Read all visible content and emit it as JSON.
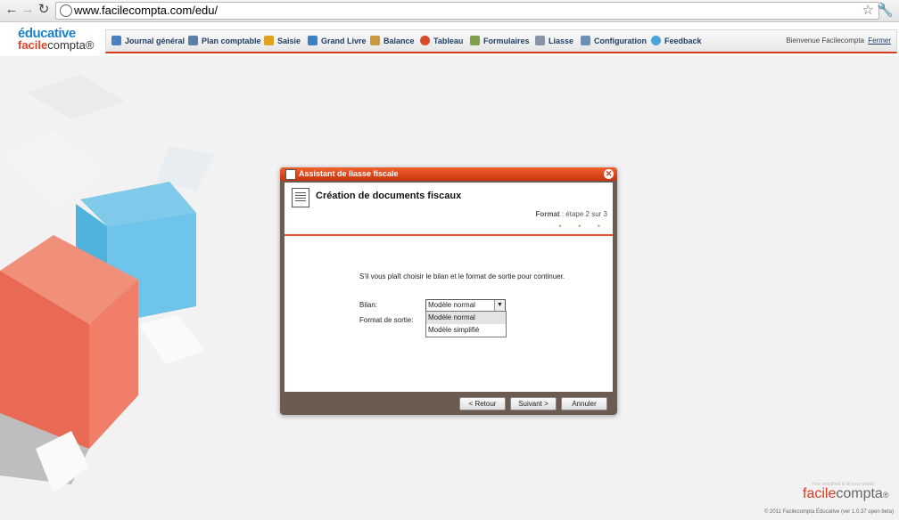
{
  "browser": {
    "url": "www.facilecompta.com/edu/",
    "back_icon": "arrow-left-icon",
    "forward_icon": "arrow-right-icon",
    "reload_icon": "reload-icon"
  },
  "logo": {
    "line1": "éducative",
    "line2a": "facile",
    "line2b": "compta",
    "mark": "®"
  },
  "menu": [
    {
      "label": "Journal général",
      "icon": "journal-icon"
    },
    {
      "label": "Plan comptable",
      "icon": "plan-icon"
    },
    {
      "label": "Saisie",
      "icon": "pencil-icon"
    },
    {
      "label": "Grand Livre",
      "icon": "book-icon"
    },
    {
      "label": "Balance",
      "icon": "balance-icon"
    },
    {
      "label": "Tableau",
      "icon": "pie-icon"
    },
    {
      "label": "Formulaires",
      "icon": "form-icon"
    },
    {
      "label": "Liasse",
      "icon": "liasse-icon"
    },
    {
      "label": "Configuration",
      "icon": "tools-icon"
    },
    {
      "label": "Feedback",
      "icon": "bubble-icon"
    }
  ],
  "user": {
    "welcome": "Bienvenue Facilecompta",
    "logout": "Fermer"
  },
  "dialog": {
    "title": "Assistant de liasse fiscale",
    "header": "Création de documents fiscaux",
    "step_name": "Format",
    "step_text": " : étape 2 sur 3",
    "dots": "• • •",
    "instruction": "S'il vous plaît choisir le bilan et le format de sortie pour continuer.",
    "bilan_label": "Bilan:",
    "format_label": "Format de sortie:",
    "bilan_selected": "Modèle normal",
    "bilan_options": [
      "Modèle normal",
      "Modèle simplifié"
    ],
    "buttons": {
      "back": "< Retour",
      "next": "Suivant >",
      "cancel": "Annuler"
    }
  },
  "brand": {
    "facile": "facile",
    "compta": "compta",
    "reg": "®",
    "tagline": "Your simplified & all your needs!"
  },
  "copyright": "© 2011 Facilecompta Éducative (ver 1.0.37 open beta)",
  "colors": {
    "accent": "#d93a1f",
    "blue": "#1e82c8",
    "dialog_frame": "#6b5b50"
  }
}
